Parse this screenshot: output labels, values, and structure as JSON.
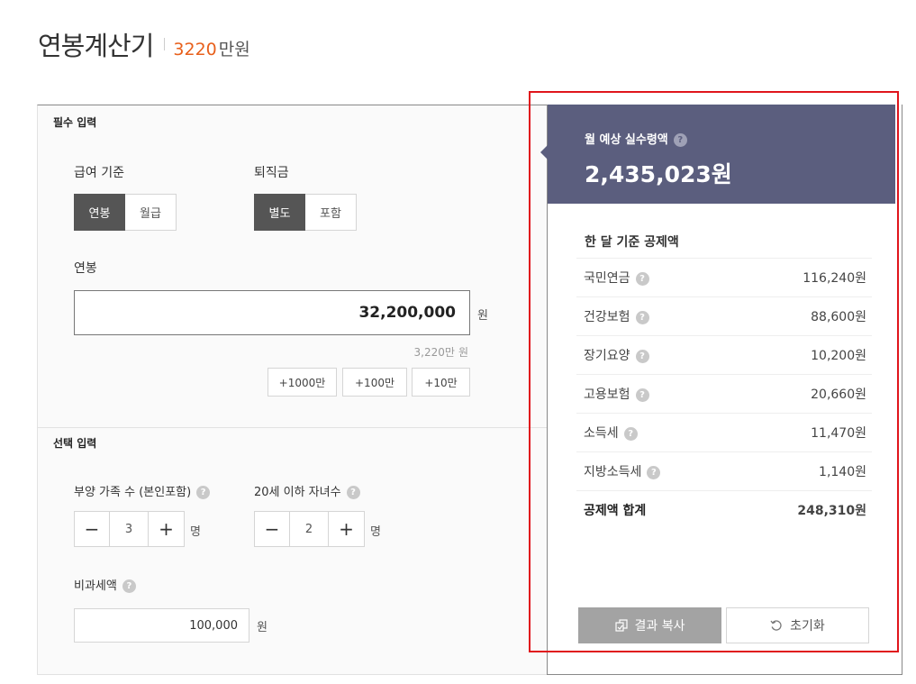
{
  "header": {
    "title": "연봉계산기",
    "amount": "3220",
    "unit": "만원"
  },
  "required": {
    "section_title": "필수 입력",
    "pay_basis": {
      "label": "급여 기준",
      "options": [
        "연봉",
        "월급"
      ],
      "selected": "연봉"
    },
    "severance": {
      "label": "퇴직금",
      "options": [
        "별도",
        "포함"
      ],
      "selected": "별도"
    },
    "salary": {
      "label": "연봉",
      "value": "32,200,000",
      "unit": "원",
      "hint_value": "3,220만",
      "hint_unit": "원"
    },
    "add_buttons": [
      "+1000만",
      "+100만",
      "+10만"
    ]
  },
  "optional": {
    "section_title": "선택 입력",
    "dependents": {
      "label": "부양 가족 수 (본인포함)",
      "minus": "−",
      "plus": "+",
      "value": "3",
      "unit": "명"
    },
    "children": {
      "label": "20세 이하 자녀수",
      "minus": "−",
      "plus": "+",
      "value": "2",
      "unit": "명"
    },
    "nontax": {
      "label": "비과세액",
      "value": "100,000",
      "unit": "원"
    }
  },
  "result": {
    "label": "월 예상 실수령액",
    "value": "2,435,023원",
    "deduction_title": "한 달 기준 공제액",
    "deductions": [
      {
        "name": "국민연금",
        "value": "116,240원"
      },
      {
        "name": "건강보험",
        "value": "88,600원"
      },
      {
        "name": "장기요양",
        "value": "10,200원"
      },
      {
        "name": "고용보험",
        "value": "20,660원"
      },
      {
        "name": "소득세",
        "value": "11,470원"
      },
      {
        "name": "지방소득세",
        "value": "1,140원"
      }
    ],
    "total": {
      "name": "공제액 합계",
      "value": "248,310원"
    },
    "copy_button": "결과 복사",
    "reset_button": "초기화"
  },
  "help_glyph": "?",
  "colors": {
    "accent": "#e8601c",
    "result_bg": "#5b5e7e",
    "highlight": "#e0151c",
    "active_toggle": "#555555"
  }
}
